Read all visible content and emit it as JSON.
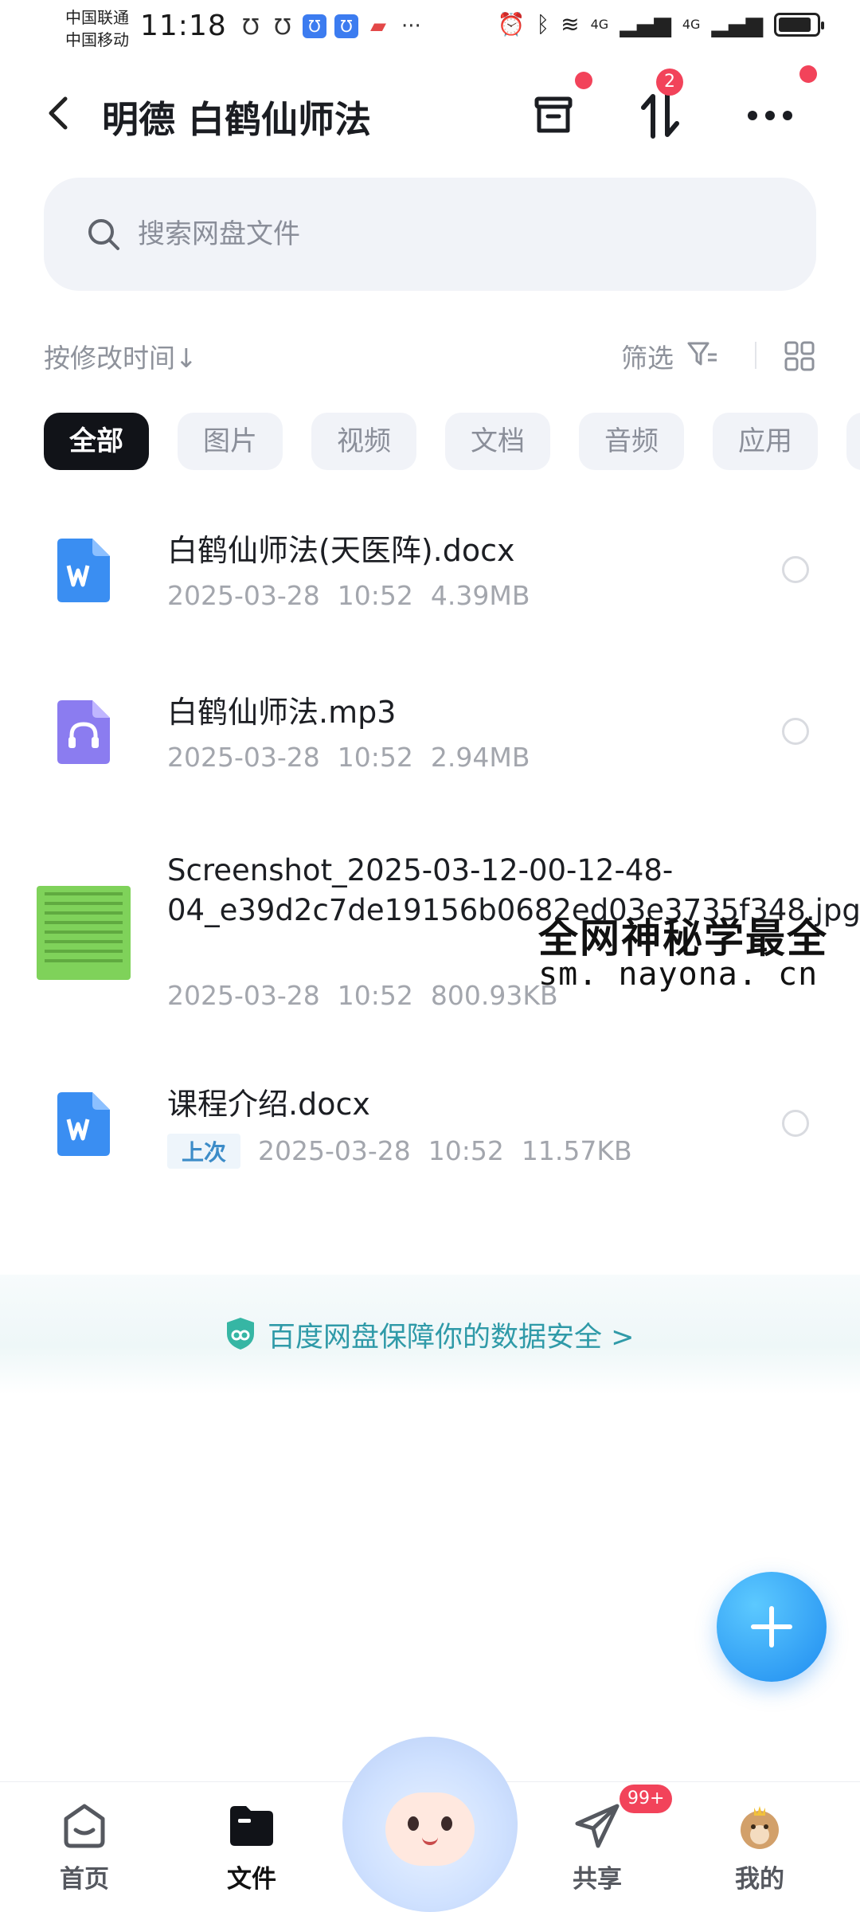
{
  "status_bar": {
    "carrier_1": "中国联通",
    "carrier_2": "中国移动",
    "time": "11:18",
    "network_1": "4G",
    "network_2": "4G"
  },
  "header": {
    "title": "明德 白鹤仙师法",
    "transfer_badge": "2"
  },
  "search": {
    "placeholder": "搜索网盘文件"
  },
  "toolbar": {
    "sort_label": "按修改时间↓",
    "filter_label": "筛选"
  },
  "categories": [
    {
      "label": "全部",
      "active": true
    },
    {
      "label": "图片",
      "active": false
    },
    {
      "label": "视频",
      "active": false
    },
    {
      "label": "文档",
      "active": false
    },
    {
      "label": "音频",
      "active": false
    },
    {
      "label": "应用",
      "active": false
    }
  ],
  "files": [
    {
      "name": "白鹤仙师法(天医阵).docx",
      "date": "2025-03-28",
      "time": "10:52",
      "size": "4.39MB",
      "icon": "word-doc-icon"
    },
    {
      "name": "白鹤仙师法.mp3",
      "date": "2025-03-28",
      "time": "10:52",
      "size": "2.94MB",
      "icon": "audio-file-icon"
    },
    {
      "name": "Screenshot_2025-03-12-00-12-48-04_e39d2c7de19156b0682ed03e3735f348.jpg",
      "date": "2025-03-28",
      "time": "10:52",
      "size": "800.93KB",
      "icon": "image-thumbnail"
    },
    {
      "name": "课程介绍.docx",
      "tag": "上次",
      "date": "2025-03-28",
      "time": "10:52",
      "size": "11.57KB",
      "icon": "word-doc-icon"
    }
  ],
  "watermark": {
    "line1": "全网神秘学最全",
    "line2": "sm. nayona. cn"
  },
  "security_banner": {
    "text": "百度网盘保障你的数据安全 >"
  },
  "bottom_nav": {
    "home": "首页",
    "files": "文件",
    "share": "共享",
    "share_badge": "99+",
    "me": "我的"
  },
  "colors": {
    "accent_blue": "#1f8cf0",
    "badge_red": "#f2435a",
    "security_teal": "#2f9aa8",
    "chip_active_bg": "#111318"
  }
}
